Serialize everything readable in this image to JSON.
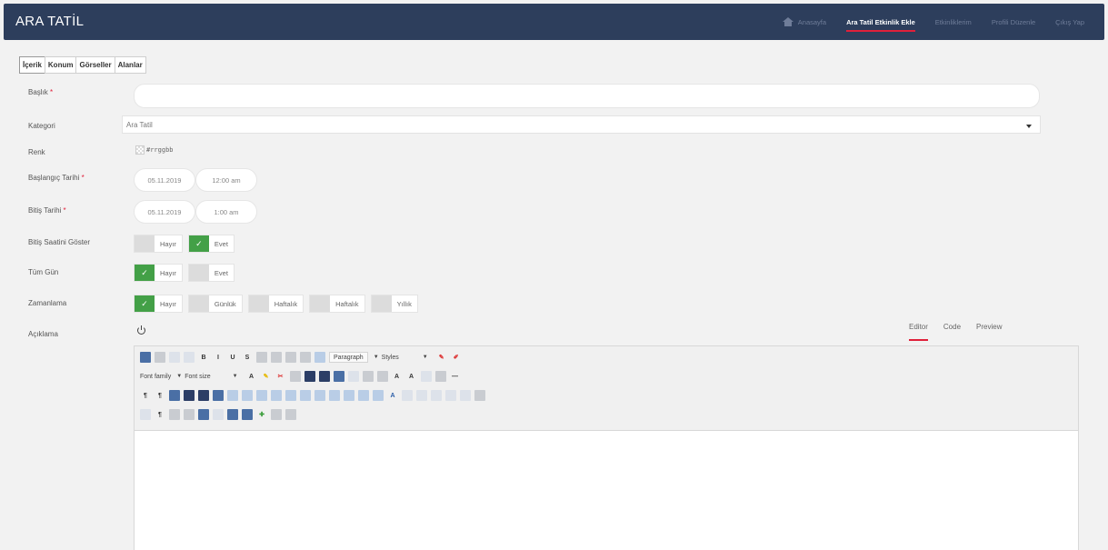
{
  "header": {
    "brand": "ARA TATİL",
    "nav": [
      {
        "label": "Anasayfa",
        "active": false
      },
      {
        "label": "Ara Tatil Etkinlik Ekle",
        "active": true
      },
      {
        "label": "Etkinliklerim",
        "active": false
      },
      {
        "label": "Profili Düzenle",
        "active": false
      },
      {
        "label": "Çıkış Yap",
        "active": false
      }
    ]
  },
  "tabs": [
    "İçerik",
    "Konum",
    "Görseller",
    "Alanlar"
  ],
  "form": {
    "baslik_label": "Başlık",
    "baslik_value": "",
    "kategori_label": "Kategori",
    "kategori_value": "Ara Tatil",
    "renk_label": "Renk",
    "renk_value": "#rrggbb",
    "baslangic_label": "Başlangıç Tarihi",
    "baslangic_date": "05.11.2019",
    "baslangic_time": "12:00 am",
    "bitis_label": "Bitiş Tarihi",
    "bitis_date": "05.11.2019",
    "bitis_time": "1:00 am",
    "bitis_saat_label": "Bitiş Saatini Göster",
    "bitis_saat_options": [
      "Hayır",
      "Evet"
    ],
    "tum_gun_label": "Tüm Gün",
    "tum_gun_options": [
      "Hayır",
      "Evet"
    ],
    "zamanlama_label": "Zamanlama",
    "zamanlama_options": [
      "Hayır",
      "Günlük",
      "Haftalık",
      "Haftalık",
      "Yıllık"
    ],
    "aciklama_label": "Açıklama",
    "required_mark": "*"
  },
  "editor": {
    "modes": [
      "Editor",
      "Code",
      "Preview"
    ],
    "paragraph": "Paragraph",
    "styles": "Styles",
    "font_family": "Font family",
    "font_size": "Font size",
    "check": "✓"
  },
  "colors": {
    "nav_bg": "#2d3e5c",
    "accent": "#e0203a",
    "toggle_on": "#43a047"
  }
}
